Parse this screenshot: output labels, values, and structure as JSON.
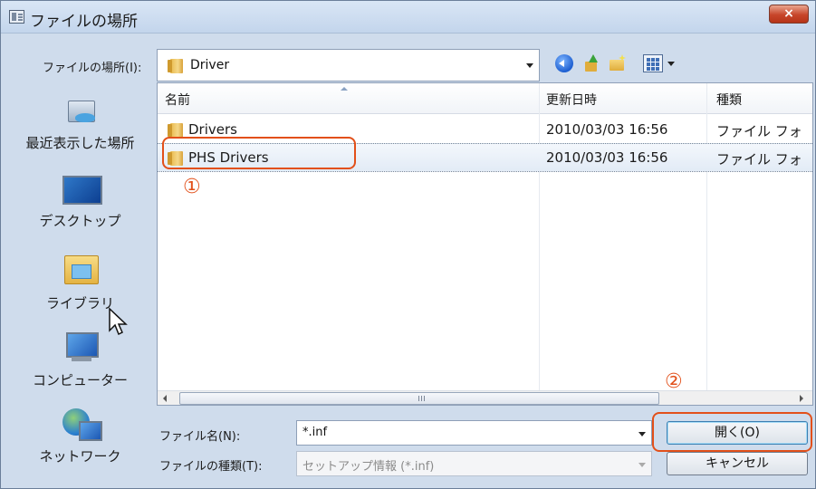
{
  "window": {
    "title": "ファイルの場所",
    "close_label": "×"
  },
  "lookin": {
    "label": "ファイルの場所(I):",
    "value": "Driver"
  },
  "places": [
    {
      "label": "最近表示した場所",
      "icon": "recent-places-icon"
    },
    {
      "label": "デスクトップ",
      "icon": "desktop-icon"
    },
    {
      "label": "ライブラリ",
      "icon": "library-icon"
    },
    {
      "label": "コンピューター",
      "icon": "computer-icon"
    },
    {
      "label": "ネットワーク",
      "icon": "network-icon"
    }
  ],
  "filelist": {
    "columns": [
      "名前",
      "更新日時",
      "種類"
    ],
    "rows": [
      {
        "name": "Drivers",
        "modified": "2010/03/03 16:56",
        "type": "ファイル フォ",
        "selected": false
      },
      {
        "name": "PHS Drivers",
        "modified": "2010/03/03 16:56",
        "type": "ファイル フォ",
        "selected": true
      }
    ],
    "scroll_grip": "III"
  },
  "filename": {
    "label": "ファイル名(N):",
    "value": "*.inf"
  },
  "filetype": {
    "label": "ファイルの種類(T):",
    "value": "セットアップ情報 (*.inf)"
  },
  "buttons": {
    "open": "開く(O)",
    "cancel": "キャンセル"
  },
  "annotations": {
    "step1": "①",
    "step2": "②",
    "color": "#e2501a"
  }
}
